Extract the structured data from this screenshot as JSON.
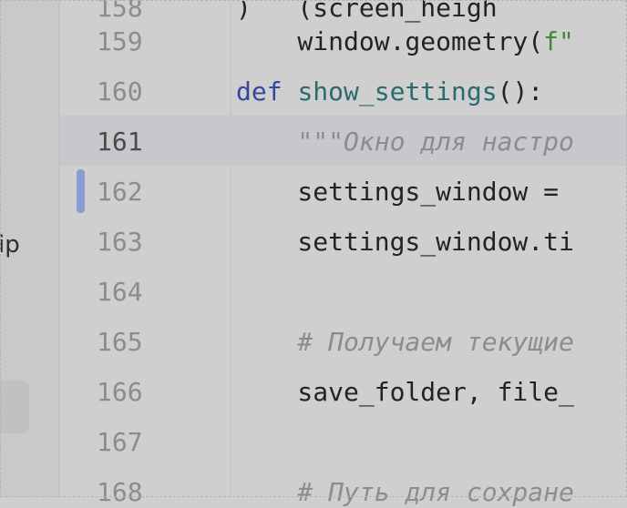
{
  "left_panel": {
    "partial_text": "ip"
  },
  "gutter": {
    "line_numbers": [
      "158",
      "159",
      "160",
      "161",
      "162",
      "163",
      "164",
      "165",
      "166",
      "167",
      "168"
    ],
    "current_line": "161"
  },
  "code": {
    "line_158": ")   (screen_heigh",
    "line_159": {
      "prefix": "    window.geometry(",
      "string": "f\""
    },
    "line_160": {
      "keyword": "def",
      "function": "show_settings",
      "rest": "():"
    },
    "line_161": "    \"\"\"Окно для настро",
    "line_162": "    settings_window = ",
    "line_163": "    settings_window.ti",
    "line_164": "",
    "line_165": "    # Получаем текущие",
    "line_166": "    save_folder, file_",
    "line_167": "",
    "line_168": "    # Путь для сохране"
  },
  "colors": {
    "background": "#cfcfcf",
    "keyword": "#33479c",
    "function": "#2a6a6f",
    "string": "#3e8a36",
    "comment": "#8c8c8c",
    "current_line": "#c7c8cb",
    "change_marker": "#8a9cd0"
  }
}
